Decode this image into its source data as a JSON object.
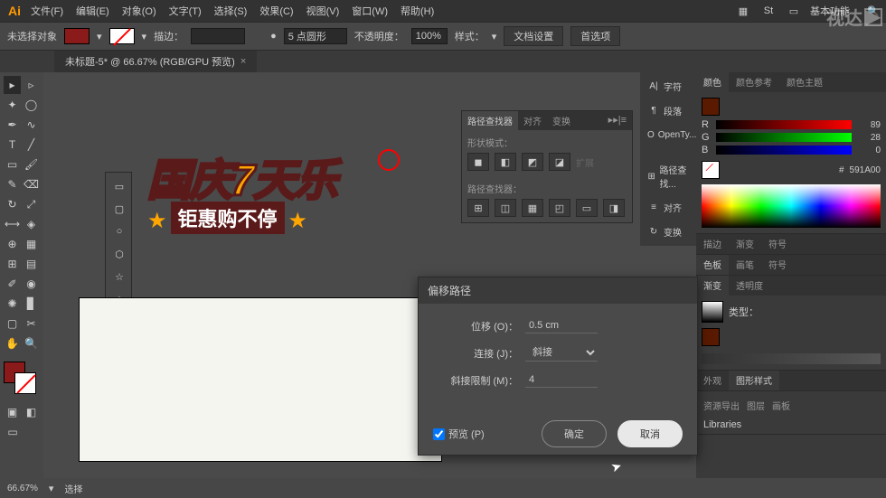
{
  "menubar": {
    "items": [
      "文件(F)",
      "编辑(E)",
      "对象(O)",
      "文字(T)",
      "选择(S)",
      "效果(C)",
      "视图(V)",
      "窗口(W)",
      "帮助(H)"
    ],
    "workspace": "基本功能"
  },
  "options": {
    "no_selection": "未选择对象",
    "stroke_label": "描边：",
    "stroke_value": "",
    "shape_label": "5 点圆形",
    "opacity_label": "不透明度：",
    "opacity_value": "100%",
    "style_label": "样式：",
    "doc_setup": "文档设置",
    "preferences": "首选项"
  },
  "tab": {
    "title": "未标题-5* @ 66.67% (RGB/GPU 预览)"
  },
  "artwork": {
    "line1": "国庆7天乐",
    "line2": "钜惠购不停"
  },
  "dock_items": [
    {
      "icon": "A|",
      "label": "字符"
    },
    {
      "icon": "¶",
      "label": "段落"
    },
    {
      "icon": "O",
      "label": "OpenTy..."
    },
    {
      "icon": "⊞",
      "label": "路径查找..."
    },
    {
      "icon": "≡",
      "label": "对齐"
    },
    {
      "icon": "↻",
      "label": "变换"
    }
  ],
  "pathfinder": {
    "tabs": [
      "路径查找器",
      "对齐",
      "变换"
    ],
    "shape_mode": "形状模式：",
    "pathfinder_label": "路径查找器：",
    "expand": "扩展"
  },
  "color_panel": {
    "tabs": [
      "颜色",
      "颜色参考",
      "颜色主题"
    ],
    "r": "89",
    "g": "28",
    "b": "0",
    "hex": "591A00"
  },
  "stroke_panel": {
    "tabs": [
      "描边",
      "渐变",
      "符号"
    ]
  },
  "swatches_panel": {
    "tabs": [
      "色板",
      "画笔",
      "符号"
    ]
  },
  "gradient_panel": {
    "tabs": [
      "渐变",
      "透明度"
    ],
    "type_label": "类型："
  },
  "appearance_panel": {
    "tabs": [
      "外观",
      "图形样式"
    ]
  },
  "layers_panel": {
    "tabs": [
      "资源导出",
      "图层",
      "画板"
    ]
  },
  "libraries": {
    "label": "Libraries"
  },
  "dialog": {
    "title": "偏移路径",
    "offset_label": "位移 (O)：",
    "offset_value": "0.5 cm",
    "join_label": "连接 (J)：",
    "join_value": "斜接",
    "miter_label": "斜接限制 (M)：",
    "miter_value": "4",
    "preview": "预览 (P)",
    "ok": "确定",
    "cancel": "取消"
  },
  "status": {
    "zoom": "66.67%",
    "selection": "选择"
  },
  "watermark": "视达"
}
